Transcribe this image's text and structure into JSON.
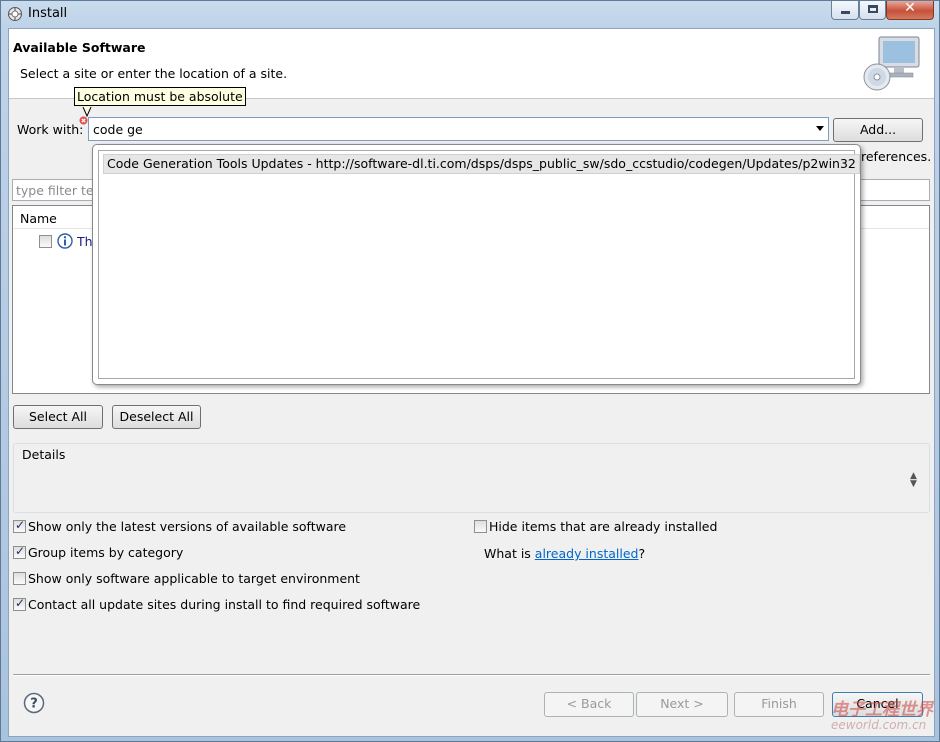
{
  "window": {
    "title": "Install"
  },
  "header": {
    "title": "Available Software",
    "description": "Select a site or enter the location of a site."
  },
  "tooltip": "Location must be absolute",
  "work_with": {
    "label": "Work with:",
    "value": "code ge",
    "add_button": "Add...",
    "preferences_text": "references."
  },
  "autocomplete": {
    "items": [
      "Code Generation Tools Updates - http://software-dl.ti.com/dsps/dsps_public_sw/sdo_ccstudio/codegen/Updates/p2win32"
    ]
  },
  "filter": {
    "placeholder": "type filter tex"
  },
  "table": {
    "column_name": "Name",
    "rows": [
      {
        "text": "Th",
        "checked": false,
        "icon": "info-icon"
      }
    ]
  },
  "buttons": {
    "select_all": "Select All",
    "deselect_all": "Deselect All",
    "back": "< Back",
    "next": "Next >",
    "finish": "Finish",
    "cancel": "Cancel"
  },
  "details": {
    "label": "Details"
  },
  "options": {
    "show_latest": {
      "label": "Show only the latest versions of available software",
      "checked": true
    },
    "hide_installed": {
      "label": "Hide items that are already installed",
      "checked": false
    },
    "group_by_category": {
      "label": "Group items by category",
      "checked": true
    },
    "what_is_prefix": "What is ",
    "already_installed_link": "already installed",
    "what_is_suffix": "?",
    "show_applicable": {
      "label": "Show only software applicable to target environment",
      "checked": false
    },
    "contact_sites": {
      "label": "Contact all update sites during install to find required software",
      "checked": true
    }
  },
  "watermark": {
    "line1": "电子工程世界",
    "line2": "eeworld.com.cn"
  },
  "colors": {
    "link": "#0066cc",
    "tooltip_bg": "#ffffe1",
    "dialog_bg": "#f0f0f0"
  }
}
